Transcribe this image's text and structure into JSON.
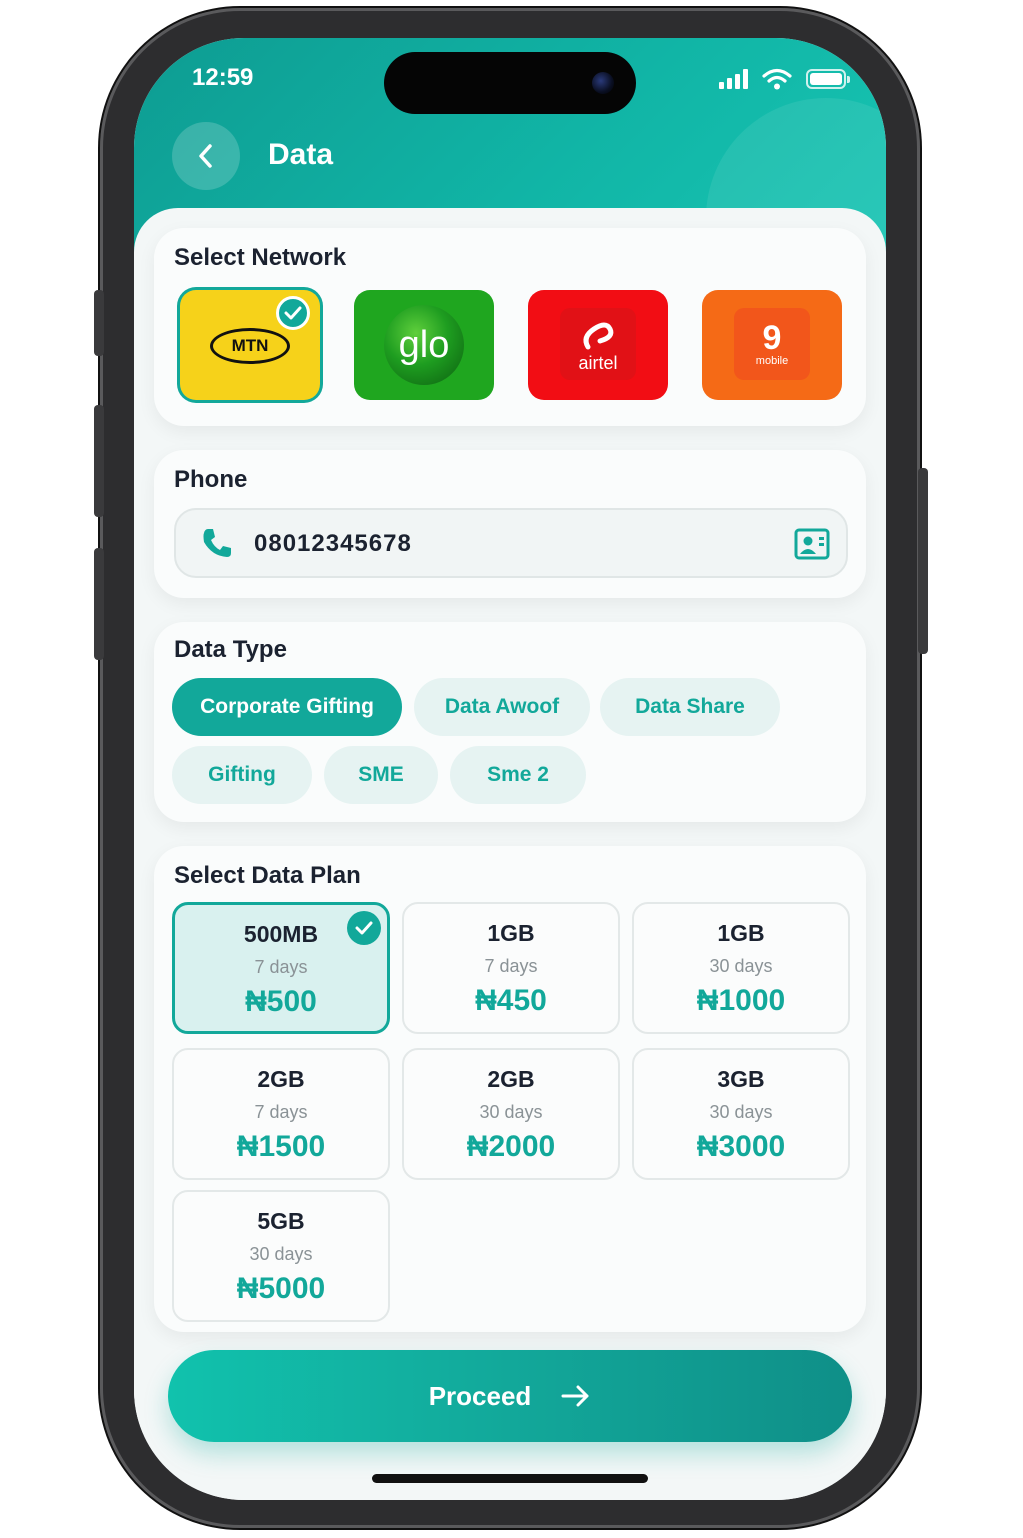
{
  "status_bar": {
    "time": "12:59"
  },
  "header": {
    "title": "Data"
  },
  "network_section": {
    "title": "Select Network",
    "networks": [
      {
        "name": "MTN",
        "logo_text": "MTN",
        "selected": true,
        "color": "#f6d21a"
      },
      {
        "name": "Glo",
        "logo_text": "glo",
        "selected": false,
        "color": "#1fa61f"
      },
      {
        "name": "Airtel",
        "logo_text": "airtel",
        "selected": false,
        "color": "#f20d14"
      },
      {
        "name": "9mobile",
        "logo_text": "9",
        "logo_sub": "mobile",
        "selected": false,
        "color": "#f56a16"
      }
    ]
  },
  "phone_section": {
    "title": "Phone",
    "value": "08012345678"
  },
  "data_type_section": {
    "title": "Data Type",
    "types": [
      {
        "label": "Corporate Gifting",
        "active": true
      },
      {
        "label": "Data Awoof",
        "active": false
      },
      {
        "label": "Data Share",
        "active": false
      },
      {
        "label": "Gifting",
        "active": false
      },
      {
        "label": "SME",
        "active": false
      },
      {
        "label": "Sme 2",
        "active": false
      }
    ]
  },
  "plan_section": {
    "title": "Select Data Plan",
    "plans": [
      {
        "size": "500MB",
        "duration": "7 days",
        "price": "₦500",
        "selected": true
      },
      {
        "size": "1GB",
        "duration": "7 days",
        "price": "₦450",
        "selected": false
      },
      {
        "size": "1GB",
        "duration": "30 days",
        "price": "₦1000",
        "selected": false
      },
      {
        "size": "2GB",
        "duration": "7 days",
        "price": "₦1500",
        "selected": false
      },
      {
        "size": "2GB",
        "duration": "30 days",
        "price": "₦2000",
        "selected": false
      },
      {
        "size": "3GB",
        "duration": "30 days",
        "price": "₦3000",
        "selected": false
      },
      {
        "size": "5GB",
        "duration": "30 days",
        "price": "₦5000",
        "selected": false
      }
    ]
  },
  "actions": {
    "proceed_label": "Proceed"
  },
  "theme": {
    "accent": "#12a89a",
    "header_gradient_start": "#0e9c92",
    "header_gradient_end": "#18c6b4"
  }
}
